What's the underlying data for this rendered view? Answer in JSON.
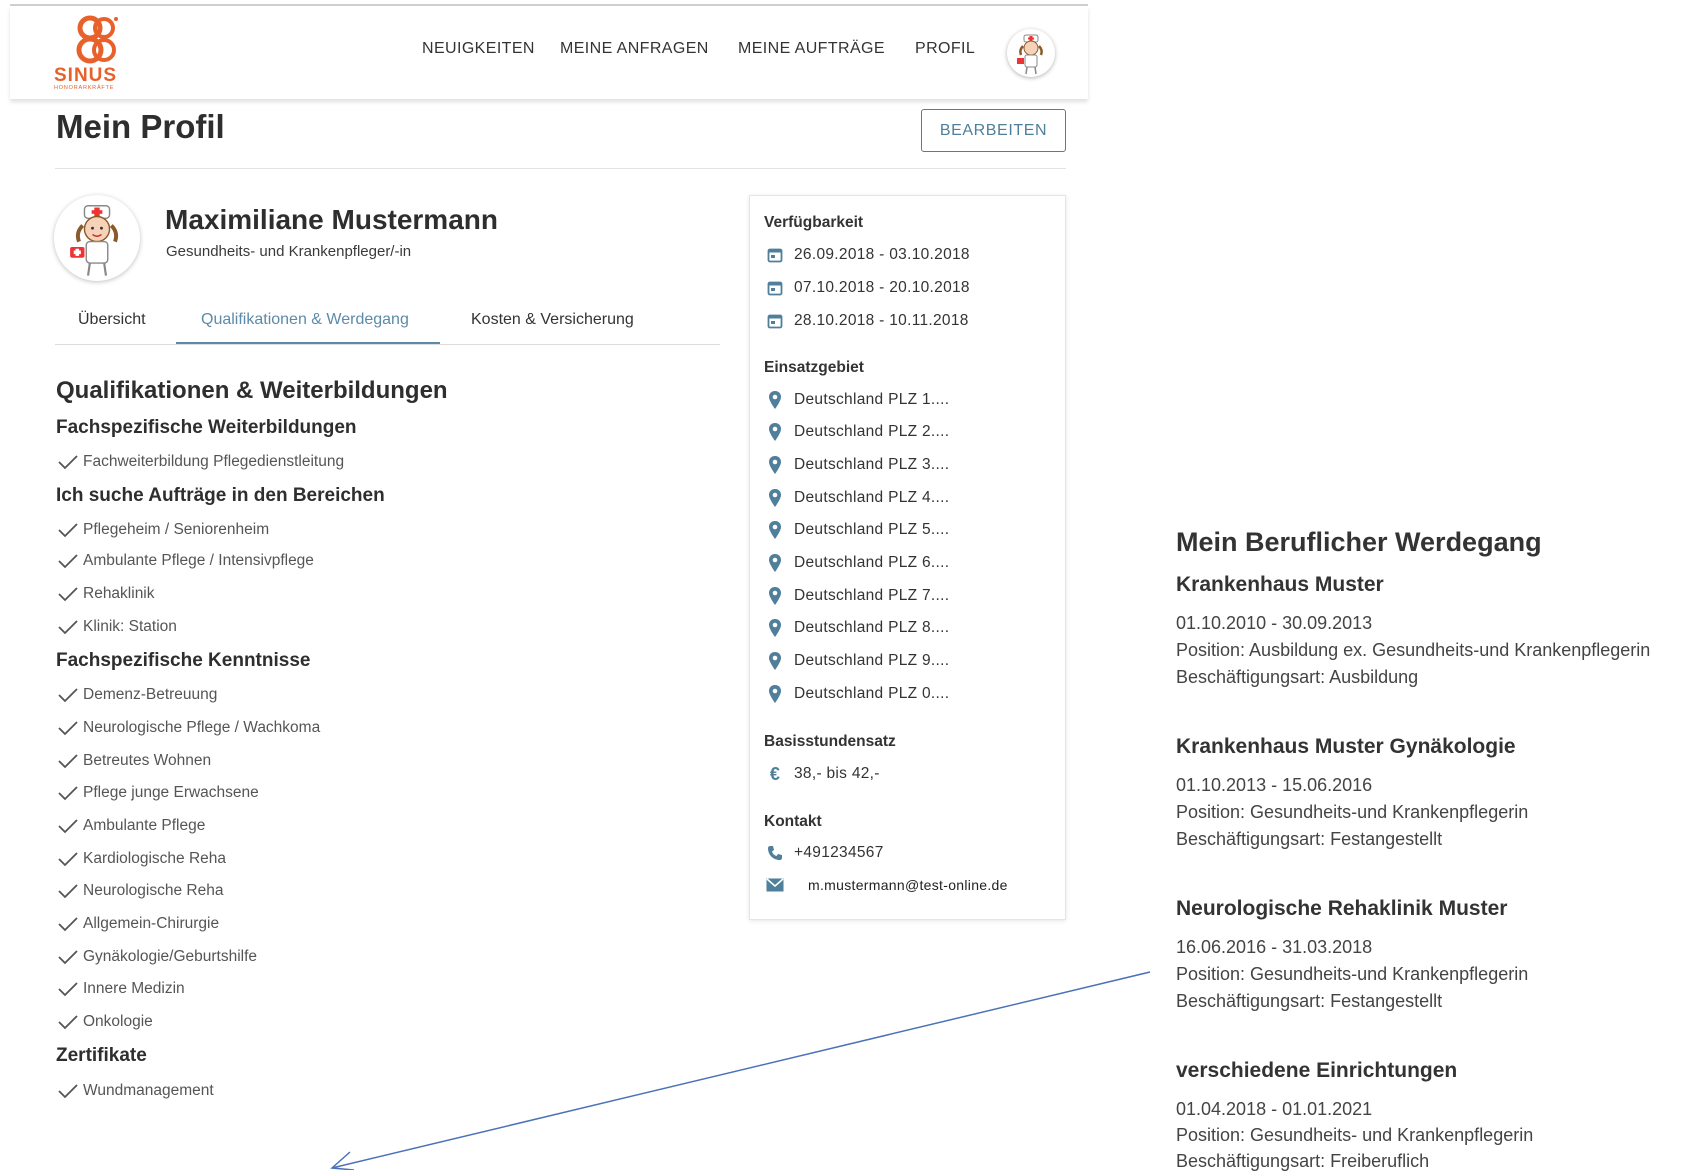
{
  "header": {
    "logo_text": "SINUS",
    "logo_subtext": "HONORARKRÄFTE",
    "nav": [
      "NEUIGKEITEN",
      "MEINE ANFRAGEN",
      "MEINE AUFTRÄGE",
      "PROFIL"
    ]
  },
  "page": {
    "title": "Mein Profil",
    "edit_label": "BEARBEITEN"
  },
  "profile": {
    "name": "Maximiliane Mustermann",
    "job": "Gesundheits- und Krankenpfleger/-in"
  },
  "tabs": [
    {
      "label": "Übersicht",
      "active": false
    },
    {
      "label": "Qualifikationen & Werdegang",
      "active": true
    },
    {
      "label": "Kosten & Versicherung",
      "active": false
    }
  ],
  "qualifications": {
    "title": "Qualifikationen & Weiterbildungen",
    "sections": [
      {
        "title": "Fachspezifische Weiterbildungen",
        "items": [
          "Fachweiterbildung Pflegedienstleitung"
        ]
      },
      {
        "title": "Ich suche Aufträge in den Bereichen",
        "items": [
          "Pflegeheim / Seniorenheim",
          "Ambulante Pflege / Intensivpflege",
          "Rehaklinik",
          "Klinik: Station"
        ]
      },
      {
        "title": "Fachspezifische Kenntnisse",
        "items": [
          "Demenz-Betreuung",
          "Neurologische Pflege / Wachkoma",
          "Betreutes Wohnen",
          "Pflege junge Erwachsene",
          "Ambulante Pflege",
          "Kardiologische Reha",
          "Neurologische Reha",
          "Allgemein-Chirurgie",
          "Gynäkologie/Geburtshilfe",
          "Innere Medizin",
          "Onkologie"
        ]
      },
      {
        "title": "Zertifikate",
        "items": [
          "Wundmanagement"
        ]
      }
    ]
  },
  "sidebar": {
    "availability_label": "Verfügbarkeit",
    "availability": [
      "26.09.2018 - 03.10.2018",
      "07.10.2018 - 20.10.2018",
      "28.10.2018 - 10.11.2018"
    ],
    "area_label": "Einsatzgebiet",
    "areas": [
      "Deutschland PLZ 1....",
      "Deutschland PLZ 2....",
      "Deutschland PLZ 3....",
      "Deutschland PLZ 4....",
      "Deutschland PLZ 5....",
      "Deutschland PLZ 6....",
      "Deutschland PLZ 7....",
      "Deutschland PLZ 8....",
      "Deutschland PLZ 9....",
      "Deutschland PLZ 0...."
    ],
    "rate_label": "Basisstundensatz",
    "rate": "38,- bis 42,-",
    "contact_label": "Kontakt",
    "phone": "+491234567",
    "email": "m.mustermann@test-online.de"
  },
  "career": {
    "title": "Mein Beruflicher Werdegang",
    "entries": [
      {
        "employer": "Krankenhaus Muster",
        "period": "01.10.2010 - 30.09.2013",
        "position": "Position: Ausbildung ex. Gesundheits-und Krankenpflegerin",
        "type": "Beschäftigungsart: Ausbildung"
      },
      {
        "employer": "Krankenhaus Muster Gynäkologie",
        "period": "01.10.2013 - 15.06.2016",
        "position": "Position: Gesundheits-und Krankenpflegerin",
        "type": "Beschäftigungsart: Festangestellt"
      },
      {
        "employer": "Neurologische Rehaklinik Muster",
        "period": "16.06.2016 - 31.03.2018",
        "position": "Position: Gesundheits-und Krankenpflegerin",
        "type": "Beschäftigungsart: Festangestellt"
      },
      {
        "employer": "verschiedene Einrichtungen",
        "period": "01.04.2018 - 01.01.2021",
        "position": "Position: Gesundheits- und Krankenpflegerin",
        "type": "Beschäftigungsart: Freiberuflich"
      }
    ]
  },
  "colors": {
    "accent": "#5b8ba8",
    "logo": "#e8602a"
  }
}
